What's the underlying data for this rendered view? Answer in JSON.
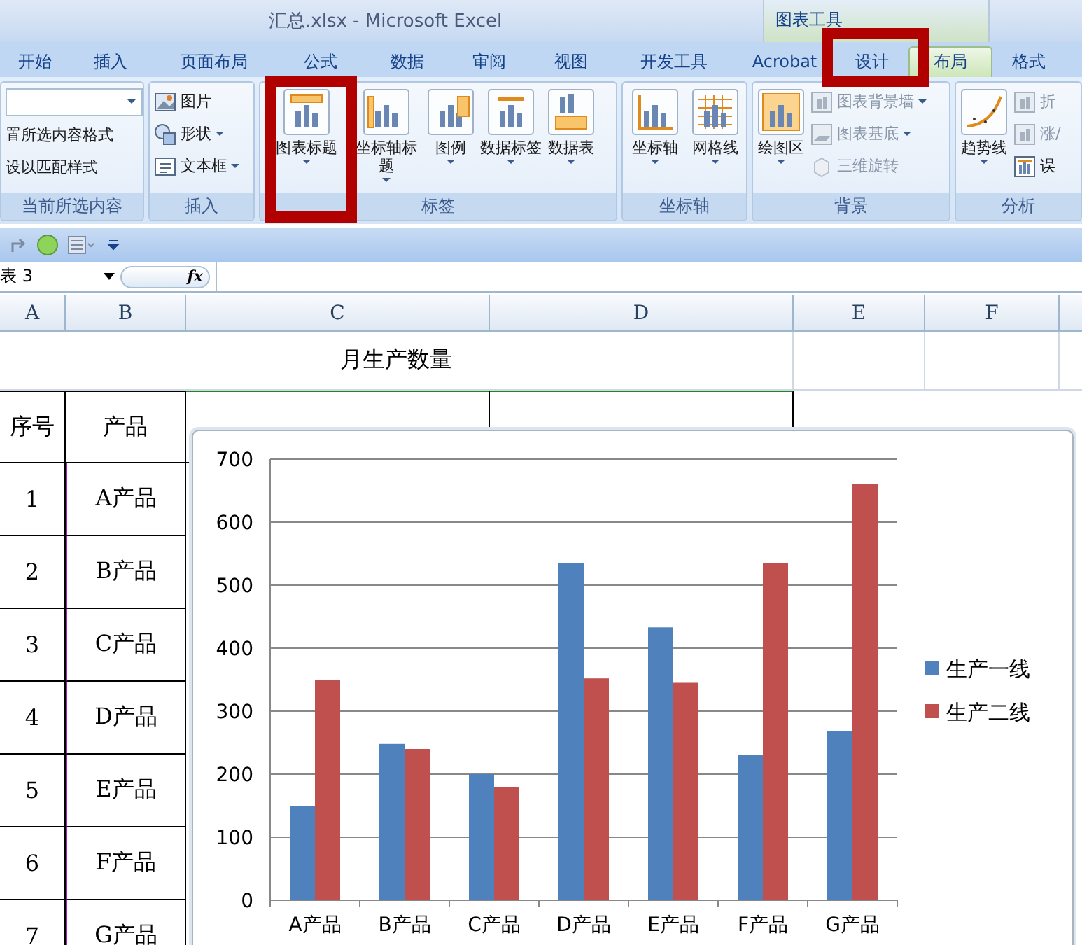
{
  "window": {
    "title": "汇总.xlsx - Microsoft Excel",
    "context_title": "图表工具"
  },
  "tabs": [
    {
      "label": "开始",
      "selected": false
    },
    {
      "label": "插入",
      "selected": false
    },
    {
      "label": "页面布局",
      "selected": false
    },
    {
      "label": "公式",
      "selected": false
    },
    {
      "label": "数据",
      "selected": false
    },
    {
      "label": "审阅",
      "selected": false
    },
    {
      "label": "视图",
      "selected": false
    },
    {
      "label": "开发工具",
      "selected": false
    },
    {
      "label": "Acrobat",
      "selected": false
    },
    {
      "label": "设计",
      "selected": false
    },
    {
      "label": "布局",
      "selected": true
    },
    {
      "label": "格式",
      "selected": false
    }
  ],
  "ribbon": {
    "groups": [
      {
        "label": "当前所选内容",
        "items": [
          {
            "kind": "combo",
            "disabled": false
          },
          {
            "kind": "small",
            "label": "置所选内容格式",
            "disabled": false
          },
          {
            "kind": "small",
            "label": "设以匹配样式",
            "disabled": false
          }
        ]
      },
      {
        "label": "插入",
        "items": [
          {
            "kind": "small",
            "label": "图片",
            "disabled": false
          },
          {
            "kind": "small",
            "label": "形状",
            "disabled": false
          },
          {
            "kind": "small",
            "label": "文本框",
            "disabled": false
          }
        ]
      },
      {
        "label": "标签",
        "items": [
          {
            "kind": "large",
            "label": "图表标题",
            "disabled": false
          },
          {
            "kind": "large",
            "label": "坐标轴标题",
            "disabled": false
          },
          {
            "kind": "large",
            "label": "图例",
            "disabled": false
          },
          {
            "kind": "large",
            "label": "数据标签",
            "disabled": false
          },
          {
            "kind": "large",
            "label": "数据表",
            "disabled": false
          }
        ]
      },
      {
        "label": "坐标轴",
        "items": [
          {
            "kind": "large",
            "label": "坐标轴",
            "disabled": false
          },
          {
            "kind": "large",
            "label": "网格线",
            "disabled": false
          }
        ]
      },
      {
        "label": "背景",
        "items": [
          {
            "kind": "large",
            "label": "绘图区",
            "disabled": false
          },
          {
            "kind": "small",
            "label": "图表背景墙",
            "disabled": true
          },
          {
            "kind": "small",
            "label": "图表基底",
            "disabled": true
          },
          {
            "kind": "small",
            "label": "三维旋转",
            "disabled": true
          }
        ]
      },
      {
        "label": "分析",
        "items": [
          {
            "kind": "large",
            "label": "趋势线",
            "disabled": false
          },
          {
            "kind": "small",
            "label": "折",
            "disabled": true
          },
          {
            "kind": "small",
            "label": "涨/",
            "disabled": true
          },
          {
            "kind": "small",
            "label": "误",
            "disabled": false
          }
        ]
      }
    ]
  },
  "formula_bar": {
    "name_box": "表 3",
    "fx": "fx"
  },
  "sheet": {
    "columns": [
      "A",
      "B",
      "C",
      "D",
      "E",
      "F"
    ],
    "title": "月生产数量",
    "header": [
      "序号",
      "产品"
    ],
    "rows": [
      [
        "1",
        "A产品"
      ],
      [
        "2",
        "B产品"
      ],
      [
        "3",
        "C产品"
      ],
      [
        "4",
        "D产品"
      ],
      [
        "5",
        "E产品"
      ],
      [
        "6",
        "F产品"
      ],
      [
        "7",
        "G产品"
      ]
    ]
  },
  "chart": {
    "chart_data": {
      "type": "bar",
      "categories": [
        "A产品",
        "B产品",
        "C产品",
        "D产品",
        "E产品",
        "F产品",
        "G产品"
      ],
      "series": [
        {
          "name": "生产一线",
          "color": "#4f81bd",
          "values": [
            150,
            248,
            200,
            535,
            433,
            230,
            268
          ]
        },
        {
          "name": "生产二线",
          "color": "#c0504d",
          "values": [
            350,
            240,
            180,
            352,
            345,
            535,
            660
          ]
        }
      ],
      "ylim": [
        0,
        700
      ],
      "yticks": [
        0,
        100,
        200,
        300,
        400,
        500,
        600,
        700
      ],
      "grid": true,
      "legend": "right"
    }
  }
}
